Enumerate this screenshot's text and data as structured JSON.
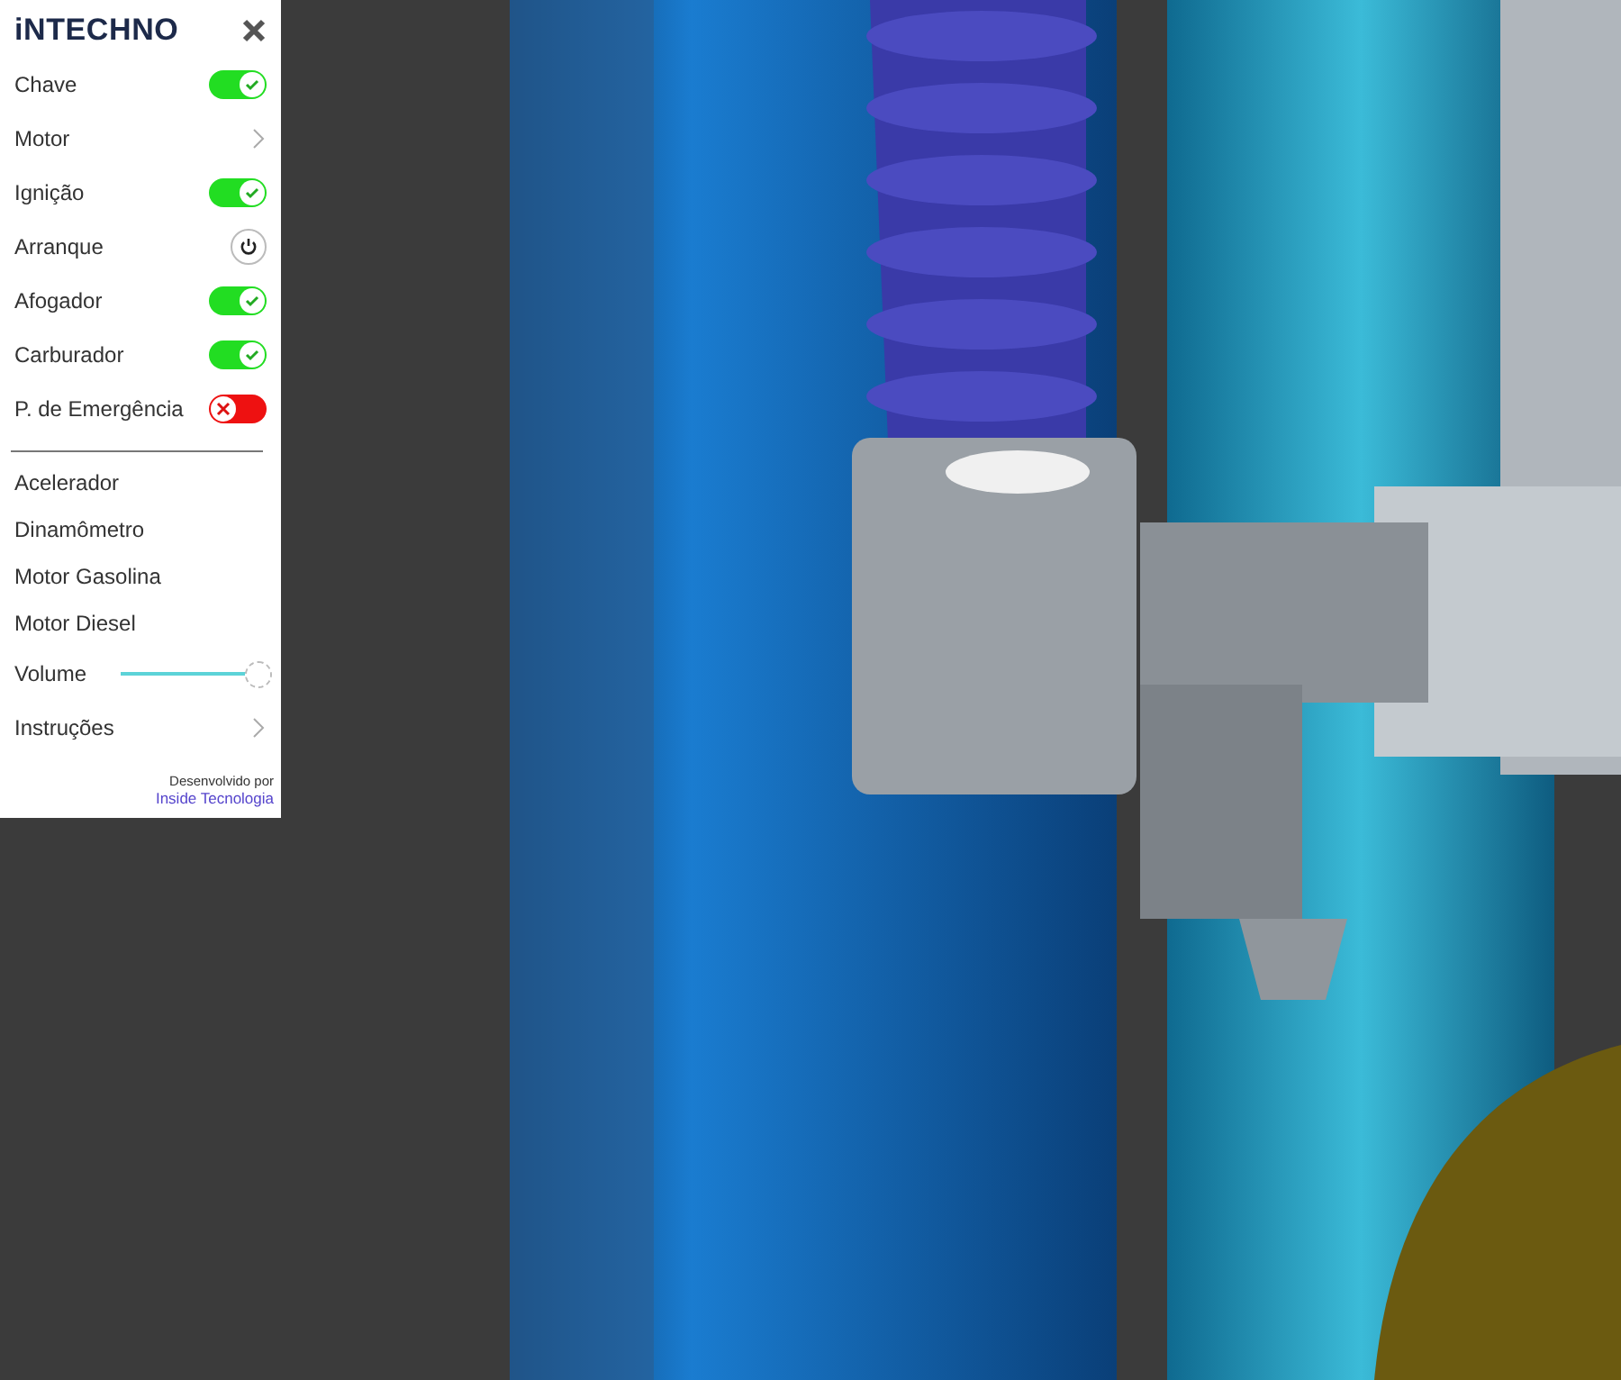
{
  "logo": {
    "text": "iNTECHNO"
  },
  "controls": [
    {
      "kind": "toggle",
      "label": "Chave",
      "on": true
    },
    {
      "kind": "submenu",
      "label": "Motor"
    },
    {
      "kind": "toggle",
      "label": "Ignição",
      "on": true
    },
    {
      "kind": "power",
      "label": "Arranque"
    },
    {
      "kind": "toggle",
      "label": "Afogador",
      "on": true
    },
    {
      "kind": "toggle",
      "label": "Carburador",
      "on": true
    },
    {
      "kind": "toggle",
      "label": "P. de Emergência",
      "on": false
    }
  ],
  "links": [
    {
      "kind": "link",
      "label": "Acelerador"
    },
    {
      "kind": "link",
      "label": "Dinamômetro"
    },
    {
      "kind": "link",
      "label": "Motor Gasolina"
    },
    {
      "kind": "link",
      "label": "Motor Diesel"
    },
    {
      "kind": "slider",
      "label": "Volume",
      "level": 1
    },
    {
      "kind": "submenu",
      "label": "Instruções"
    }
  ],
  "credit": {
    "text": "Desenvolvido por",
    "link": "Inside Tecnologia"
  }
}
